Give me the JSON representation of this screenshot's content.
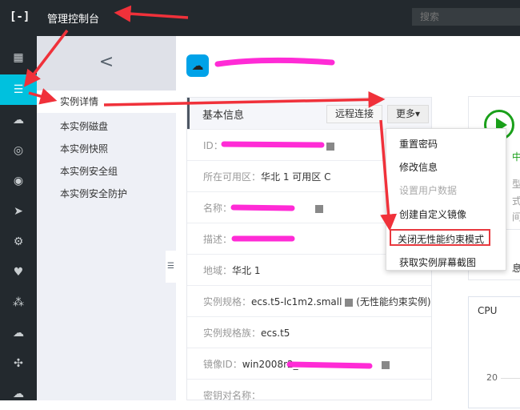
{
  "topbar": {
    "logo": "[-]",
    "title": "管理控制台",
    "search_placeholder": "搜索"
  },
  "rail": {
    "icons": [
      "grid-icon",
      "instances-icon",
      "cloud-upload-icon",
      "globe-icon",
      "dns-icon",
      "cdn-icon",
      "settings-icon",
      "shield-icon",
      "network-icon",
      "cloud-icon",
      "connect-icon",
      "cloud-monitor-icon"
    ],
    "active_index": 1,
    "accent": "#00c1de"
  },
  "sidebar": {
    "back": "<",
    "items": [
      {
        "label": "实例详情",
        "active": true
      },
      {
        "label": "本实例磁盘"
      },
      {
        "label": "本实例快照"
      },
      {
        "label": "本实例安全组"
      },
      {
        "label": "本实例安全防护"
      }
    ]
  },
  "basic": {
    "title": "基本信息",
    "remote_btn": "远程连接",
    "more_btn": "更多▾",
    "rows": [
      {
        "label": "ID：",
        "value": ""
      },
      {
        "label": "所在可用区：",
        "value": "华北 1 可用区 C"
      },
      {
        "label": "名称：",
        "value": ""
      },
      {
        "label": "描述：",
        "value": ""
      },
      {
        "label": "地域：",
        "value": "华北 1"
      },
      {
        "label": "实例规格：",
        "value": "ecs.t5-lc1m2.small",
        "extra": "(无性能约束实例)"
      },
      {
        "label": "实例规格族：",
        "value": "ecs.t5"
      },
      {
        "label": "镜像ID：",
        "value": "win2008r2_"
      },
      {
        "label": "密钥对名称：",
        "value": ""
      }
    ]
  },
  "menu": {
    "items": [
      {
        "label": "重置密码"
      },
      {
        "label": "修改信息"
      },
      {
        "label": "设置用户数据",
        "disabled": true
      },
      {
        "label": "创建自定义镜像"
      },
      {
        "label": "关闭无性能约束模式",
        "highlighted": true
      },
      {
        "label": "获取实例屏幕截图"
      }
    ]
  },
  "status": {
    "text": "中",
    "lines": [
      "型",
      "式",
      "间"
    ],
    "section": "息",
    "color": "#1aa01a"
  },
  "cpu": {
    "title": "CPU",
    "tick": "20"
  }
}
